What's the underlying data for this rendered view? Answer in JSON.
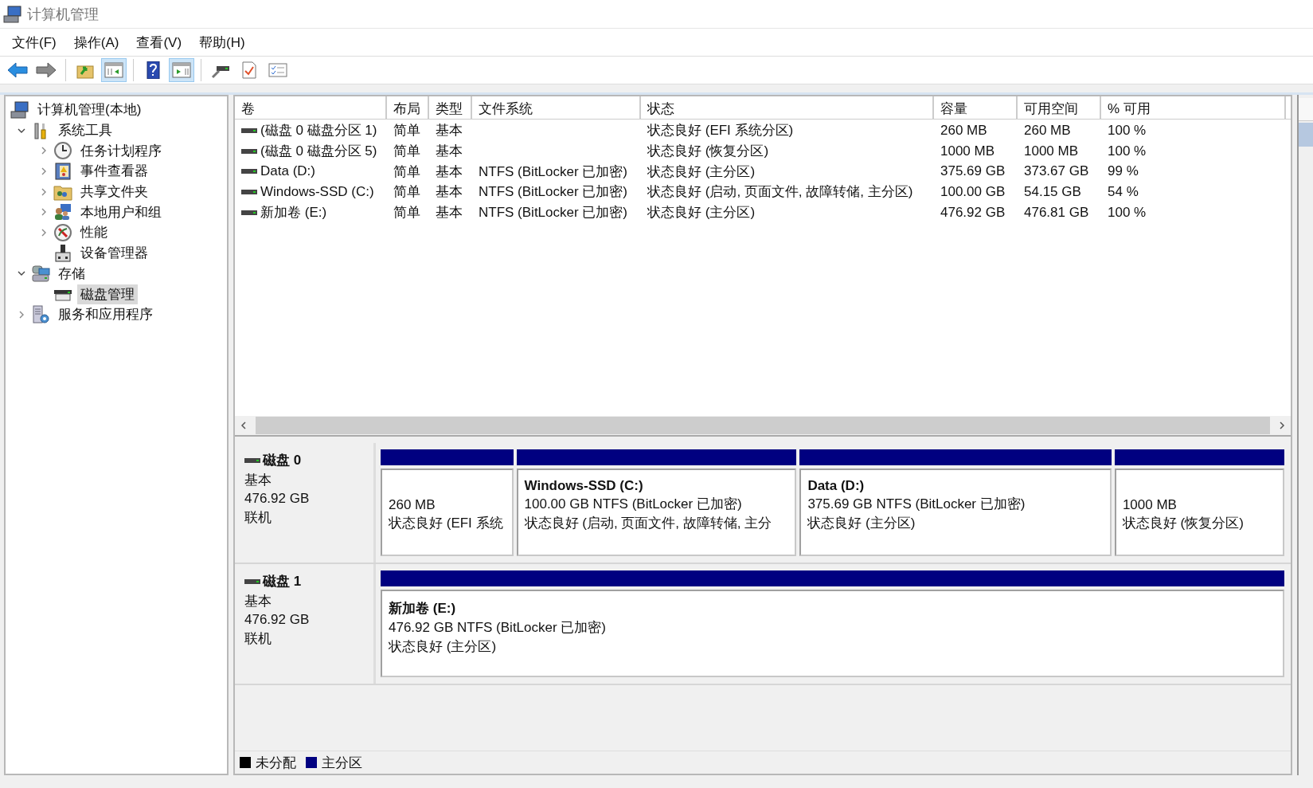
{
  "window": {
    "title": "计算机管理"
  },
  "menu": [
    {
      "label": "文件(F)"
    },
    {
      "label": "操作(A)"
    },
    {
      "label": "查看(V)"
    },
    {
      "label": "帮助(H)"
    }
  ],
  "toolbar": [
    {
      "kind": "back",
      "pressed": false
    },
    {
      "kind": "forward",
      "pressed": false
    },
    {
      "kind": "sep"
    },
    {
      "kind": "up",
      "pressed": false
    },
    {
      "kind": "tree",
      "pressed": true
    },
    {
      "kind": "sep"
    },
    {
      "kind": "help",
      "pressed": false
    },
    {
      "kind": "pane",
      "pressed": true
    },
    {
      "kind": "sep"
    },
    {
      "kind": "connect",
      "pressed": false
    },
    {
      "kind": "check",
      "pressed": false
    },
    {
      "kind": "list",
      "pressed": false
    }
  ],
  "tree": [
    {
      "label": "计算机管理(本地)",
      "kind": "computer",
      "selected": false,
      "children": [
        {
          "label": "系统工具",
          "kind": "tools",
          "selected": false,
          "expanded": true,
          "children": [
            {
              "label": "任务计划程序",
              "kind": "clock",
              "selected": false,
              "expanded": false
            },
            {
              "label": "事件查看器",
              "kind": "log",
              "selected": false,
              "expanded": false
            },
            {
              "label": "共享文件夹",
              "kind": "share",
              "selected": false,
              "expanded": false
            },
            {
              "label": "本地用户和组",
              "kind": "users",
              "selected": false,
              "expanded": false
            },
            {
              "label": "性能",
              "kind": "gauge",
              "selected": false,
              "expanded": false
            },
            {
              "label": "设备管理器",
              "kind": "device",
              "selected": false
            }
          ]
        },
        {
          "label": "存储",
          "kind": "storage",
          "selected": false,
          "expanded": true,
          "children": [
            {
              "label": "磁盘管理",
              "kind": "disk",
              "selected": true
            }
          ]
        },
        {
          "label": "服务和应用程序",
          "kind": "services",
          "selected": false,
          "expanded": false
        }
      ]
    }
  ],
  "table": {
    "columns": [
      "卷",
      "布局",
      "类型",
      "文件系统",
      "状态",
      "容量",
      "可用空间",
      "% 可用"
    ],
    "rows": [
      [
        "(磁盘 0 磁盘分区 1)",
        "简单",
        "基本",
        "",
        "状态良好 (EFI 系统分区)",
        "260 MB",
        "260 MB",
        "100 %"
      ],
      [
        "(磁盘 0 磁盘分区 5)",
        "简单",
        "基本",
        "",
        "状态良好 (恢复分区)",
        "1000 MB",
        "1000 MB",
        "100 %"
      ],
      [
        "Data (D:)",
        "简单",
        "基本",
        "NTFS (BitLocker 已加密)",
        "状态良好 (主分区)",
        "375.69 GB",
        "373.67 GB",
        "99 %"
      ],
      [
        "Windows-SSD (C:)",
        "简单",
        "基本",
        "NTFS (BitLocker 已加密)",
        "状态良好 (启动, 页面文件, 故障转储, 主分区)",
        "100.00 GB",
        "54.15 GB",
        "54 %"
      ],
      [
        "新加卷 (E:)",
        "简单",
        "基本",
        "NTFS (BitLocker 已加密)",
        "状态良好 (主分区)",
        "476.92 GB",
        "476.81 GB",
        "100 %"
      ]
    ]
  },
  "disks": [
    {
      "name": "磁盘 0",
      "type": "基本",
      "size": "476.92 GB",
      "state": "联机",
      "partitions": [
        {
          "kind": "primary",
          "size": "260 MB",
          "status": "状态良好 (EFI 系统"
        },
        {
          "kind": "primary",
          "title": "Windows-SSD  (C:)",
          "size": "100.00 GB NTFS (BitLocker 已加密)",
          "status": "状态良好 (启动, 页面文件, 故障转储, 主分"
        },
        {
          "kind": "primary",
          "title": "Data  (D:)",
          "size": "375.69 GB NTFS (BitLocker 已加密)",
          "status": "状态良好 (主分区)"
        },
        {
          "kind": "primary",
          "size": "1000 MB",
          "status": "状态良好 (恢复分区)"
        }
      ]
    },
    {
      "name": "磁盘 1",
      "type": "基本",
      "size": "476.92 GB",
      "state": "联机",
      "partitions": [
        {
          "kind": "primary",
          "title": "新加卷  (E:)",
          "size": "476.92 GB NTFS (BitLocker 已加密)",
          "status": "状态良好 (主分区)"
        }
      ]
    }
  ],
  "legend": [
    {
      "label": "未分配",
      "color": "#000000"
    },
    {
      "label": "主分区",
      "color": "#000080"
    }
  ]
}
